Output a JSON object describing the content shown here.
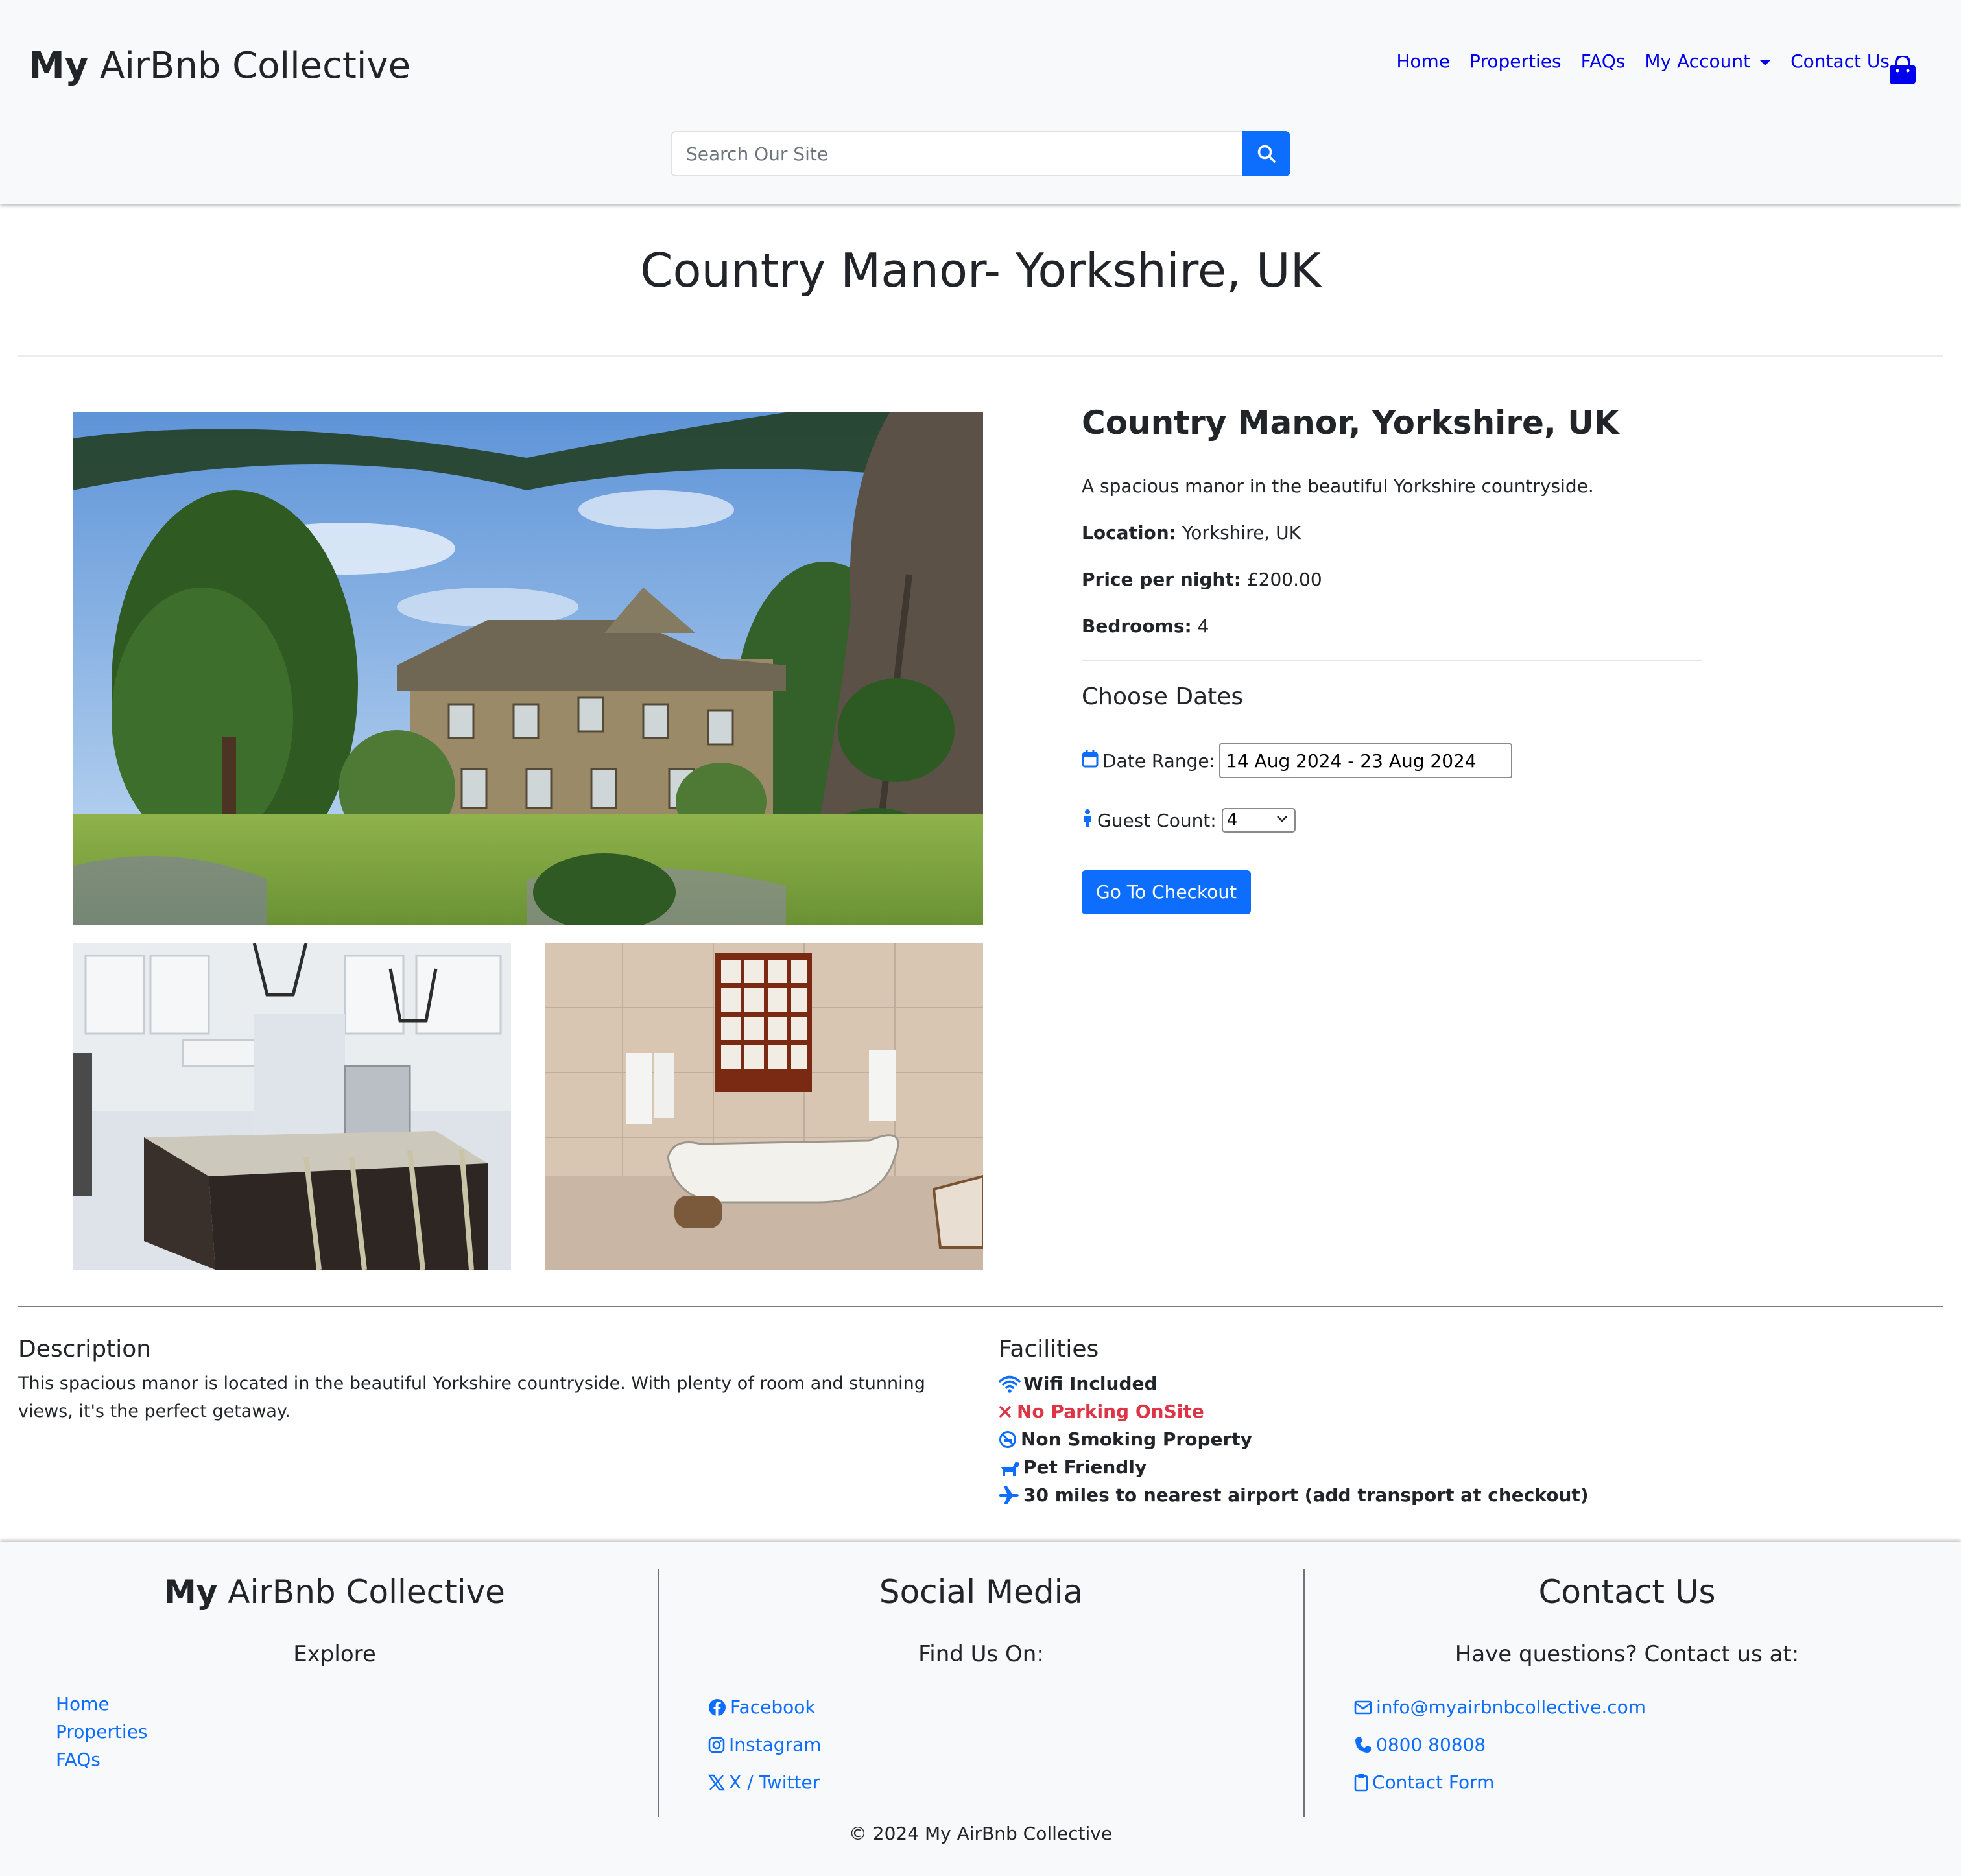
{
  "brand": {
    "bold": "My",
    "rest": " AirBnb Collective"
  },
  "nav": {
    "home": "Home",
    "properties": "Properties",
    "faqs": "FAQs",
    "account": "My Account",
    "contact": "Contact Us"
  },
  "search": {
    "placeholder": "Search Our Site"
  },
  "page_title": "Country Manor- Yorkshire, UK",
  "property": {
    "name": "Country Manor, Yorkshire, UK",
    "summary": "A spacious manor in the beautiful Yorkshire countryside.",
    "location_label": "Location:",
    "location": "Yorkshire, UK",
    "price_label": "Price per night:",
    "price": "£200.00",
    "bedrooms_label": "Bedrooms:",
    "bedrooms": "4"
  },
  "booking": {
    "choose_dates": "Choose Dates",
    "date_label": "Date Range:",
    "date_value": "14 Aug 2024 - 23 Aug 2024",
    "guest_label": "Guest Count:",
    "guest_value": "4",
    "checkout_button": "Go To Checkout"
  },
  "description": {
    "heading": "Description",
    "text": "This spacious manor is located in the beautiful Yorkshire countryside. With plenty of room and stunning views, it's the perfect getaway."
  },
  "facilities": {
    "heading": "Facilities",
    "items": [
      {
        "label": "Wifi Included",
        "icon": "wifi-icon"
      },
      {
        "label": "No Parking OnSite",
        "icon": "x-icon"
      },
      {
        "label": "Non Smoking Property",
        "icon": "no-smoking-icon"
      },
      {
        "label": "Pet Friendly",
        "icon": "dog-icon"
      },
      {
        "label": "30 miles to nearest airport (add transport at checkout)",
        "icon": "plane-icon"
      }
    ]
  },
  "footer": {
    "brand_bold": "My",
    "brand_rest": " AirBnb Collective",
    "explore_heading": "Explore",
    "explore_links": [
      "Home",
      "Properties",
      "FAQs"
    ],
    "social_heading": "Social Media",
    "social_sub": "Find Us On:",
    "social_links": [
      "Facebook",
      "Instagram",
      "X / Twitter"
    ],
    "contact_heading": "Contact Us",
    "contact_sub": "Have questions? Contact us at:",
    "email": "info@myairbnbcollective.com",
    "phone": "0800 80808",
    "contact_form": "Contact Form",
    "copyright": "© 2024 My AirBnb Collective"
  },
  "colors": {
    "primary": "#0d6efd",
    "nav_link": "#0000ee",
    "danger": "#dc3545",
    "header_bg": "#f8f9fa"
  }
}
